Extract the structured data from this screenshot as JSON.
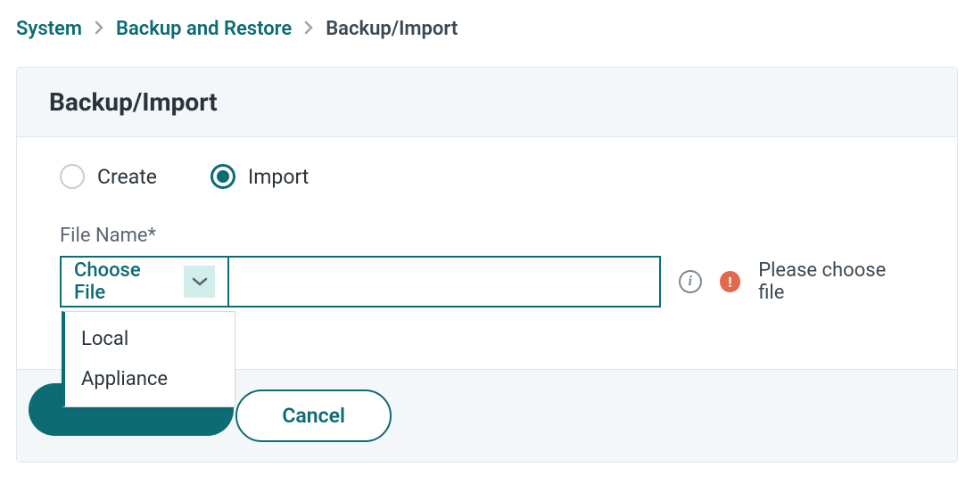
{
  "breadcrumb": {
    "system": "System",
    "backup_restore": "Backup and Restore",
    "current": "Backup/Import"
  },
  "panel": {
    "title": "Backup/Import"
  },
  "radios": {
    "create": "Create",
    "import": "Import"
  },
  "file": {
    "label": "File Name*",
    "choose": "Choose File",
    "value": "",
    "error": "Please choose file",
    "options": [
      "Local",
      "Appliance"
    ]
  },
  "buttons": {
    "cancel": "Cancel"
  }
}
